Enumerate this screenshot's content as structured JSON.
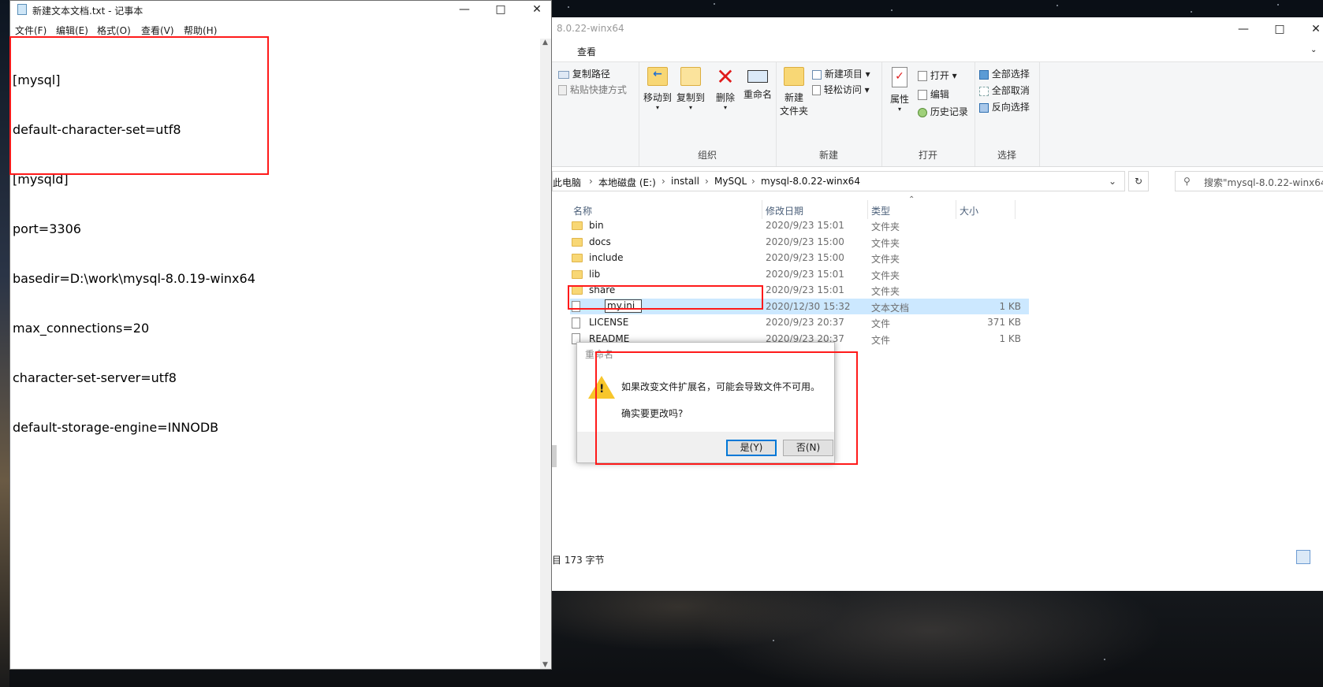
{
  "notepad": {
    "title": "新建文本文档.txt - 记事本",
    "menu": [
      "文件(F)",
      "编辑(E)",
      "格式(O)",
      "查看(V)",
      "帮助(H)"
    ],
    "lines": [
      "[mysql]",
      "default-character-set=utf8",
      "[mysqld]",
      "port=3306",
      "basedir=D:\\work\\mysql-8.0.19-winx64",
      "max_connections=20",
      "character-set-server=utf8",
      "default-storage-engine=INNODB"
    ]
  },
  "explorer": {
    "title": "8.0.22-winx64",
    "tab": "查看",
    "ribbon": {
      "clipboard": {
        "copy_path": "复制路径",
        "paste_shortcut": "粘贴快捷方式"
      },
      "organize": {
        "move_to": "移动到",
        "copy_to": "复制到",
        "delete": "删除",
        "rename": "重命名",
        "label": "组织"
      },
      "new": {
        "new_folder_line1": "新建",
        "new_folder_line2": "文件夹",
        "new_item": "新建项目",
        "easy_access": "轻松访问",
        "label": "新建"
      },
      "open": {
        "properties": "属性",
        "open": "打开",
        "edit": "编辑",
        "history": "历史记录",
        "label": "打开"
      },
      "select": {
        "select_all": "全部选择",
        "select_none": "全部取消",
        "invert": "反向选择",
        "label": "选择"
      }
    },
    "breadcrumb": [
      "此电脑",
      "本地磁盘 (E:)",
      "install",
      "MySQL",
      "mysql-8.0.22-winx64"
    ],
    "search_placeholder": "搜索\"mysql-8.0.22-winx64\"",
    "columns": {
      "name": "名称",
      "date": "修改日期",
      "type": "类型",
      "size": "大小"
    },
    "files": [
      {
        "name": "bin",
        "date": "2020/9/23 15:01",
        "type": "文件夹",
        "size": "",
        "kind": "folder"
      },
      {
        "name": "docs",
        "date": "2020/9/23 15:00",
        "type": "文件夹",
        "size": "",
        "kind": "folder"
      },
      {
        "name": "include",
        "date": "2020/9/23 15:00",
        "type": "文件夹",
        "size": "",
        "kind": "folder"
      },
      {
        "name": "lib",
        "date": "2020/9/23 15:01",
        "type": "文件夹",
        "size": "",
        "kind": "folder"
      },
      {
        "name": "share",
        "date": "2020/9/23 15:01",
        "type": "文件夹",
        "size": "",
        "kind": "folder"
      },
      {
        "name": "my.ini",
        "date": "2020/12/30 15:32",
        "type": "文本文档",
        "size": "1 KB",
        "kind": "text",
        "selected": true
      },
      {
        "name": "LICENSE",
        "date": "2020/9/23 20:37",
        "type": "文件",
        "size": "371 KB",
        "kind": "file"
      },
      {
        "name": "README",
        "date": "2020/9/23 20:37",
        "type": "文件",
        "size": "1 KB",
        "kind": "file"
      }
    ],
    "status": "目 173 字节"
  },
  "dialog": {
    "title": "重命名",
    "message": "如果改变文件扩展名，可能会导致文件不可用。",
    "question": "确实要更改吗?",
    "yes": "是(Y)",
    "no": "否(N)"
  },
  "colors": {
    "highlight": "#ff1a1a",
    "selection": "#cce8ff",
    "accent": "#0078d7"
  }
}
